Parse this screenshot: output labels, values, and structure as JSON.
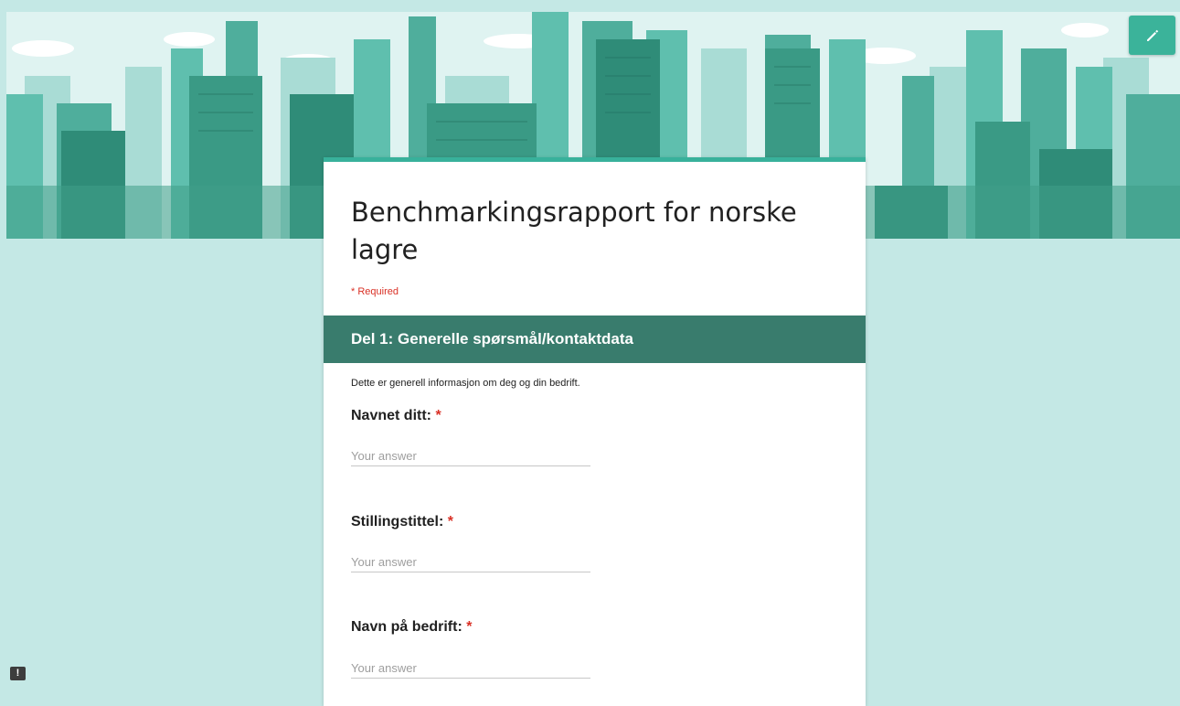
{
  "header": {
    "banner_icon": "city-skyline",
    "edit_icon": "pencil-icon",
    "accent_color": "#38b19b",
    "section_color": "#397c6d"
  },
  "form": {
    "title": "Benchmarkingsrapport for norske lagre",
    "required_note": "* Required"
  },
  "section": {
    "title": "Del 1: Generelle spørsmål/kontaktdata",
    "description": "Dette er generell informasjon om deg og din bedrift."
  },
  "questions": [
    {
      "label": "Navnet ditt:",
      "required_marker": "*",
      "placeholder": "Your answer"
    },
    {
      "label": "Stillingstittel:",
      "required_marker": "*",
      "placeholder": "Your answer"
    },
    {
      "label": "Navn på bedrift:",
      "required_marker": "*",
      "placeholder": "Your answer"
    }
  ],
  "footer": {
    "feedback_label": "!",
    "feedback_icon": "report-icon"
  }
}
